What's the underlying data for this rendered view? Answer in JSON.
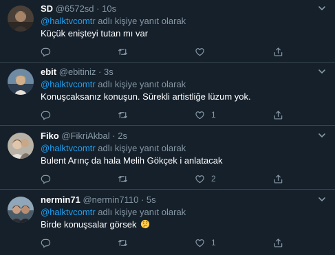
{
  "tweets": [
    {
      "name": "SD",
      "handle": "@6572sd",
      "separator": "·",
      "time": "10s",
      "reply_mention": "@halktvcomtr",
      "reply_suffix": " adlı kişiye yanıt olarak",
      "text": "Küçük enişteyi tutan mı var",
      "reply_count": "",
      "retweet_count": "",
      "like_count": "",
      "avatar_icon": "profile-photo"
    },
    {
      "name": "ebit",
      "handle": "@ebitiniz",
      "separator": "·",
      "time": "3s",
      "reply_mention": "@halktvcomtr",
      "reply_suffix": " adlı kişiye yanıt olarak",
      "text": "Konuşcaksanız konuşun. Sürekli artistliğe lüzum yok.",
      "reply_count": "",
      "retweet_count": "",
      "like_count": "1",
      "avatar_icon": "profile-photo"
    },
    {
      "name": "Fiko",
      "handle": "@FikriAkbal",
      "separator": "·",
      "time": "2s",
      "reply_mention": "@halktvcomtr",
      "reply_suffix": " adlı kişiye yanıt olarak",
      "text": "Bulent Arınç da hala Melih Gökçek i anlatacak",
      "reply_count": "",
      "retweet_count": "",
      "like_count": "2",
      "avatar_icon": "profile-photo"
    },
    {
      "name": "nermin71",
      "handle": "@nermin7110",
      "separator": "·",
      "time": "5s",
      "reply_mention": "@halktvcomtr",
      "reply_suffix": " adlı kişiye yanıt olarak",
      "text": "Birde konuşsalar görsek",
      "reply_count": "",
      "retweet_count": "",
      "like_count": "1",
      "avatar_icon": "profile-photo",
      "emoji": "thinking-face-emoji"
    }
  ],
  "colors": {
    "background": "#15202b",
    "divider": "#38444d",
    "secondary_text": "#8899a6",
    "link": "#1da1f2",
    "primary_text": "#ffffff"
  }
}
